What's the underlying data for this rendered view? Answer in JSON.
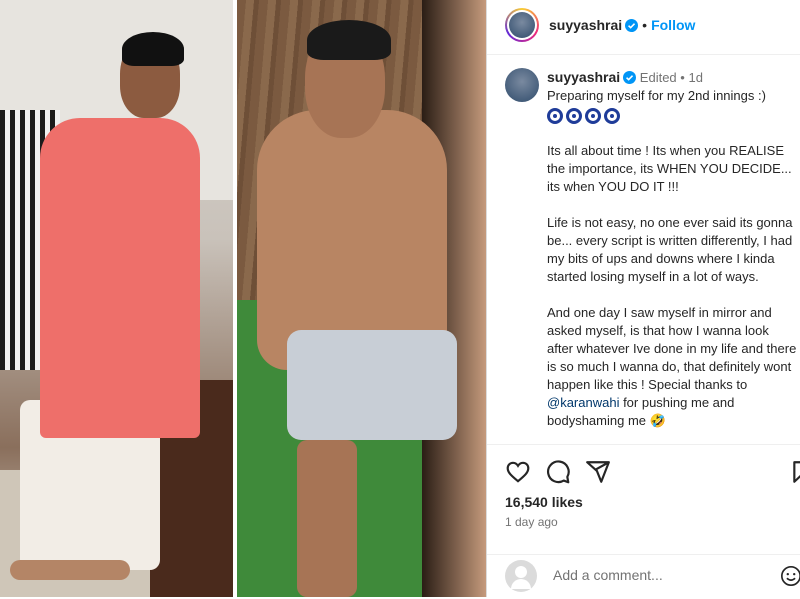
{
  "header": {
    "username": "suyyashrai",
    "separator": "•",
    "follow_label": "Follow"
  },
  "caption": {
    "username": "suyyashrai",
    "edited_label": "Edited",
    "separator": "•",
    "age": "1d",
    "line1": "Preparing myself for my 2nd innings :)",
    "para1": "Its all about time ! Its when you REALISE the importance, its WHEN YOU DECIDE... its when YOU DO IT !!!",
    "para2": "Life is not easy, no one ever said its gonna be... every script is written differently, I had my bits of ups and downs where I kinda started losing myself in a lot of ways.",
    "para3_start": "And one day I saw myself in mirror and asked myself, is that how I wanna look after whatever Ive done in my life and there is so much I wanna do, that definitely wont happen like this ! Special thanks to ",
    "mention": "@karanwahi",
    "para3_end": " for pushing me and bodyshaming me 🤣"
  },
  "actions": {
    "icons": [
      "heart-icon",
      "comment-icon",
      "share-icon",
      "bookmark-icon"
    ]
  },
  "likes": "16,540 likes",
  "timestamp": "1 day ago",
  "comment": {
    "placeholder": "Add a comment..."
  },
  "colors": {
    "follow": "#0095f6",
    "verified": "#0095f6",
    "muted": "#737373",
    "mention": "#00376b"
  }
}
